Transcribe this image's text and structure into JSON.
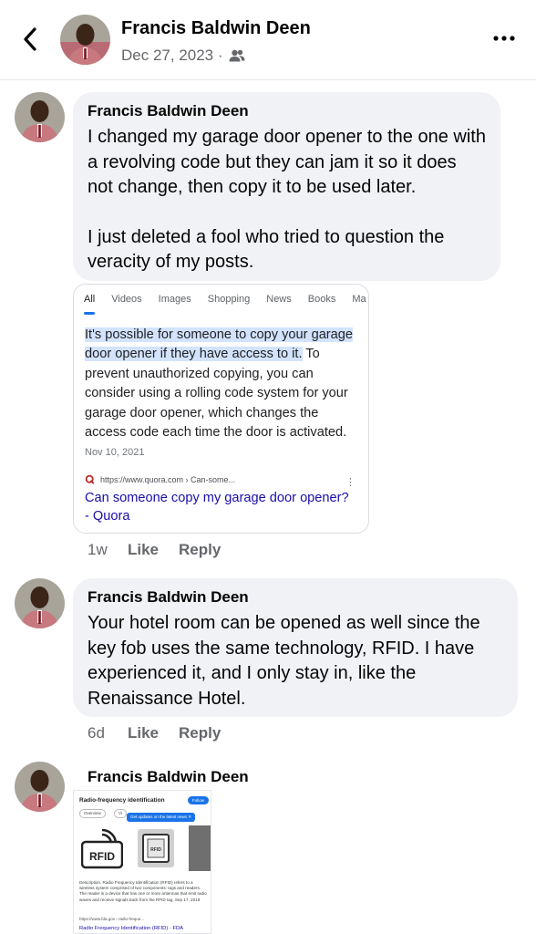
{
  "header": {
    "back_icon": "chevron-left-icon",
    "name": "Francis Baldwin Deen",
    "date": "Dec 27, 2023 ·",
    "audience_icon": "friends-icon",
    "more_icon": "more-horizontal-icon"
  },
  "comments": [
    {
      "name": "Francis Baldwin Deen",
      "paragraphs": [
        "I changed my garage door opener to the one with a revolving code but they can jam it so it does not change, then copy it to be used later.",
        "I just deleted a fool who tried to question the veracity of my posts."
      ],
      "time": "1w",
      "like": "Like",
      "reply": "Reply"
    },
    {
      "name": "Francis Baldwin Deen",
      "paragraphs": [
        "Your hotel room can be opened as well since the key fob uses the same technology, RFID. I have experienced it, and I only stay in, like the Renaissance Hotel."
      ],
      "time": "6d",
      "like": "Like",
      "reply": "Reply"
    },
    {
      "name": "Francis Baldwin Deen"
    }
  ],
  "google_card": {
    "tabs": [
      "All",
      "Videos",
      "Images",
      "Shopping",
      "News",
      "Books",
      "Ma"
    ],
    "highlight": "It's possible for someone to copy your garage door opener if they have access to it.",
    "snippet": " To prevent unauthorized copying, you can consider using a rolling code system for your garage door opener, which changes the access code each time the door is activated.",
    "date": "Nov 10, 2021",
    "source": "https://www.quora.com › Can-some...",
    "link": "Can someone copy my garage door opener? - Quora"
  },
  "rfid_card": {
    "title": "Radio-frequency identification",
    "follow": "Follow",
    "chip_overview": "Overview",
    "chip_v": "Vi",
    "tooltip": "Get updates on the latest news",
    "img_label": "RFID",
    "description": "Description. Radio Frequency Identification (RFID) refers to a wireless system comprised of two components: tags and readers. The reader is a device that has one or more antennas that emit radio waves and receive signals back from the RFID tag.  Sep 17, 2018",
    "source": "https://www.fda.gov › radio-freque...",
    "link": "Radio Frequency Identification (RFID) - FDA"
  }
}
